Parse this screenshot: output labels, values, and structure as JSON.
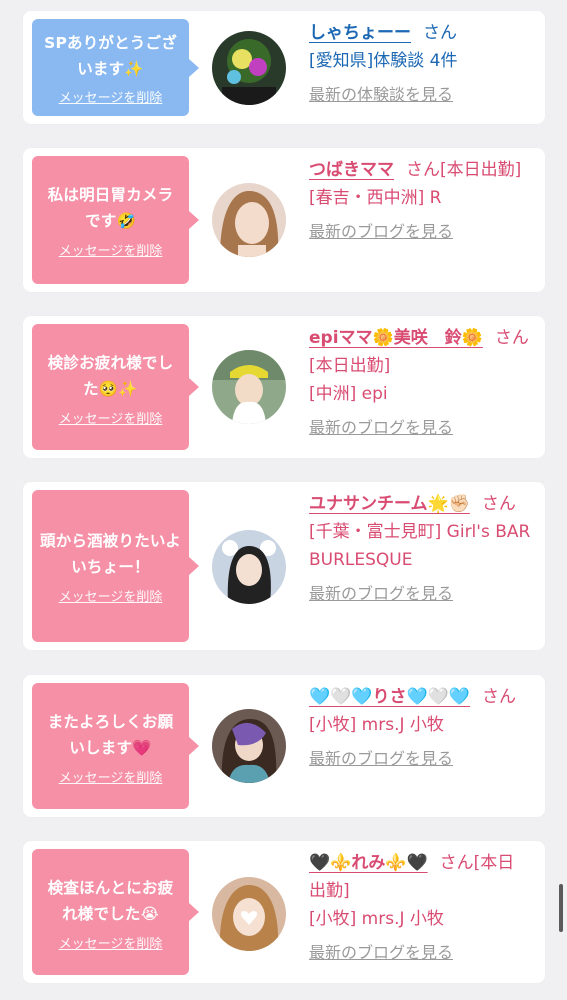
{
  "colors": {
    "pink": "#f590a6",
    "blue": "#8ab9f1",
    "name_blue": "#1c68b4",
    "name_pink": "#d94c72",
    "meta_blue": "#1c68b4",
    "meta_pink": "#d94c72",
    "gray": "#9a9a9a"
  },
  "cards": [
    {
      "bubble_text": "SPありがとうございます✨",
      "delete_label": "メッセージを削除",
      "name": "しゃちょーー",
      "suffix": "さん",
      "meta": "[愛知県]体験談 4件",
      "more": "最新の体験談を見る",
      "theme": "blue"
    },
    {
      "bubble_text": "私は明日胃カメラです🤣",
      "delete_label": "メッセージを削除",
      "name": "つばきママ",
      "suffix": "さん[本日出勤]",
      "meta": "[春吉・西中洲] R",
      "more": "最新のブログを見る",
      "theme": "pink"
    },
    {
      "bubble_text": "検診お疲れ様でした🥺✨",
      "delete_label": "メッセージを削除",
      "name": "epiママ🌼美咲　鈴🌼",
      "suffix": "さん[本日出勤]",
      "meta": "[中洲] epi",
      "more": "最新のブログを見る",
      "theme": "pink"
    },
    {
      "bubble_text": "頭から酒被りたいよいちょー！",
      "delete_label": "メッセージを削除",
      "name": "ユナサンチーム🌟✊🏻",
      "suffix": "さん",
      "meta": "[千葉・富士見町] Girl's BAR BURLESQUE",
      "more": "最新のブログを見る",
      "theme": "pink"
    },
    {
      "bubble_text": "またよろしくお願いします💗",
      "delete_label": "メッセージを削除",
      "name": "🩵🤍🩵りさ🩵🤍🩵",
      "suffix": "さん",
      "meta": "[小牧] mrs.J 小牧",
      "more": "最新のブログを見る",
      "theme": "pink"
    },
    {
      "bubble_text": "検査ほんとにお疲れ様でした😭",
      "delete_label": "メッセージを削除",
      "name": "🖤⚜️れみ⚜️🖤",
      "suffix": "さん[本日出勤]",
      "meta": "[小牧] mrs.J 小牧",
      "more": "最新のブログを見る",
      "theme": "pink"
    }
  ]
}
